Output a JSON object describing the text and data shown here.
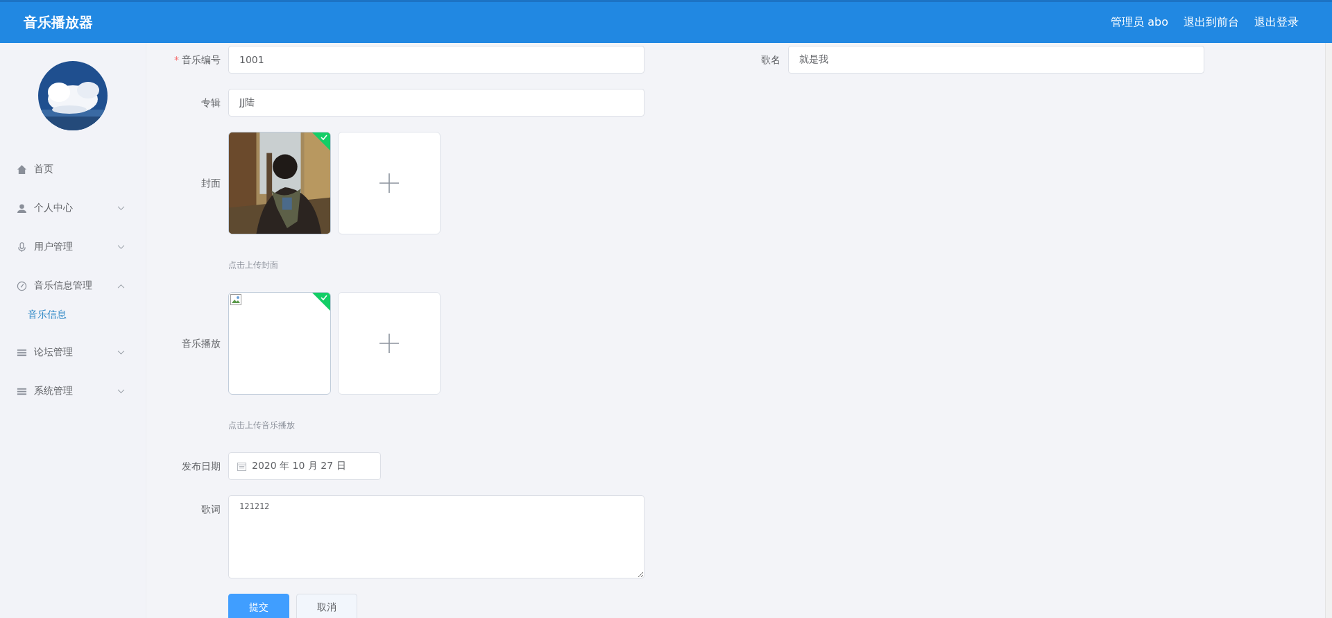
{
  "header": {
    "title": "音乐播放器",
    "user": "管理员 abo",
    "links": [
      "退出到前台",
      "退出登录"
    ]
  },
  "sidebar": {
    "items": [
      {
        "label": "首页"
      },
      {
        "label": "个人中心",
        "expanded": false
      },
      {
        "label": "用户管理",
        "expanded": false
      },
      {
        "label": "音乐信息管理",
        "expanded": true,
        "children": [
          {
            "label": "音乐信息",
            "selected": true
          }
        ]
      },
      {
        "label": "论坛管理",
        "expanded": false
      },
      {
        "label": "系统管理",
        "expanded": false
      }
    ]
  },
  "form": {
    "music_no": {
      "label": "音乐编号",
      "required_mark": "*",
      "value": "1001"
    },
    "song_name": {
      "label": "歌名",
      "value": "就是我"
    },
    "album": {
      "label": "专辑",
      "value": "JJ陆"
    },
    "cover": {
      "label": "封面",
      "file": {
        "kind": "picture",
        "uploaded": true
      },
      "hint": "点击上传封面"
    },
    "music": {
      "label": "音乐播放",
      "file": {
        "kind": "broken",
        "uploaded": true
      },
      "hint": "点击上传音乐播放"
    },
    "date": {
      "label": "发布日期",
      "value": "2020 年 10 月 27 日"
    },
    "lyrics": {
      "label": "歌词",
      "value": "121212"
    },
    "buttons": [
      {
        "label": "提交",
        "kind": "primary"
      },
      {
        "label": "取消",
        "kind": "plain"
      }
    ]
  }
}
